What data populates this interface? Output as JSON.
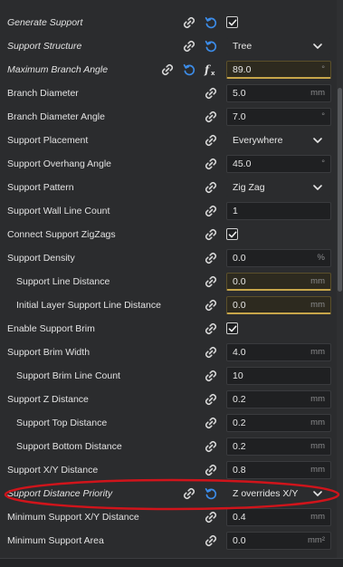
{
  "settings": {
    "rows": [
      {
        "label": "Generate Support",
        "italic": true,
        "indent": false,
        "type": "check",
        "checked": true,
        "icons": [
          "link",
          "reset"
        ]
      },
      {
        "label": "Support Structure",
        "italic": true,
        "indent": false,
        "type": "select",
        "value": "Tree",
        "icons": [
          "link",
          "reset"
        ]
      },
      {
        "label": "Maximum Branch Angle",
        "italic": true,
        "indent": false,
        "type": "field",
        "value": "89.0",
        "unit": "°",
        "warn": true,
        "icons": [
          "link",
          "reset",
          "fx"
        ]
      },
      {
        "label": "Branch Diameter",
        "italic": false,
        "indent": false,
        "type": "field",
        "value": "5.0",
        "unit": "mm",
        "icons": [
          "link"
        ]
      },
      {
        "label": "Branch Diameter Angle",
        "italic": false,
        "indent": false,
        "type": "field",
        "value": "7.0",
        "unit": "°",
        "icons": [
          "link"
        ]
      },
      {
        "label": "Support Placement",
        "italic": false,
        "indent": false,
        "type": "select",
        "value": "Everywhere",
        "icons": [
          "link"
        ]
      },
      {
        "label": "Support Overhang Angle",
        "italic": false,
        "indent": false,
        "type": "field",
        "value": "45.0",
        "unit": "°",
        "icons": [
          "link"
        ]
      },
      {
        "label": "Support Pattern",
        "italic": false,
        "indent": false,
        "type": "select",
        "value": "Zig Zag",
        "icons": [
          "link"
        ]
      },
      {
        "label": "Support Wall Line Count",
        "italic": false,
        "indent": false,
        "type": "field",
        "value": "1",
        "unit": "",
        "icons": [
          "link"
        ]
      },
      {
        "label": "Connect Support ZigZags",
        "italic": false,
        "indent": false,
        "type": "check",
        "checked": true,
        "icons": [
          "link"
        ]
      },
      {
        "label": "Support Density",
        "italic": false,
        "indent": false,
        "type": "field",
        "value": "0.0",
        "unit": "%",
        "icons": [
          "link"
        ]
      },
      {
        "label": "Support Line Distance",
        "italic": false,
        "indent": true,
        "type": "field",
        "value": "0.0",
        "unit": "mm",
        "warn": true,
        "icons": [
          "link"
        ]
      },
      {
        "label": "Initial Layer Support Line Distance",
        "italic": false,
        "indent": true,
        "type": "field",
        "value": "0.0",
        "unit": "mm",
        "warn": true,
        "icons": [
          "link"
        ]
      },
      {
        "label": "Enable Support Brim",
        "italic": false,
        "indent": false,
        "type": "check",
        "checked": true,
        "icons": [
          "link"
        ]
      },
      {
        "label": "Support Brim Width",
        "italic": false,
        "indent": false,
        "type": "field",
        "value": "4.0",
        "unit": "mm",
        "icons": [
          "link"
        ]
      },
      {
        "label": "Support Brim Line Count",
        "italic": false,
        "indent": true,
        "type": "field",
        "value": "10",
        "unit": "",
        "icons": [
          "link"
        ]
      },
      {
        "label": "Support Z Distance",
        "italic": false,
        "indent": false,
        "type": "field",
        "value": "0.2",
        "unit": "mm",
        "icons": [
          "link"
        ]
      },
      {
        "label": "Support Top Distance",
        "italic": false,
        "indent": true,
        "type": "field",
        "value": "0.2",
        "unit": "mm",
        "icons": [
          "link"
        ]
      },
      {
        "label": "Support Bottom Distance",
        "italic": false,
        "indent": true,
        "type": "field",
        "value": "0.2",
        "unit": "mm",
        "icons": [
          "link"
        ]
      },
      {
        "label": "Support X/Y Distance",
        "italic": false,
        "indent": false,
        "type": "field",
        "value": "0.8",
        "unit": "mm",
        "icons": [
          "link"
        ]
      },
      {
        "label": "Support Distance Priority",
        "italic": true,
        "indent": false,
        "type": "select",
        "value": "Z overrides X/Y",
        "icons": [
          "link",
          "reset"
        ]
      },
      {
        "label": "Minimum Support X/Y Distance",
        "italic": false,
        "indent": false,
        "type": "field",
        "value": "0.4",
        "unit": "mm",
        "icons": [
          "link"
        ]
      },
      {
        "label": "Minimum Support Area",
        "italic": false,
        "indent": false,
        "type": "field",
        "value": "0.0",
        "unit": "mm²",
        "icons": [
          "link"
        ]
      }
    ]
  },
  "colors": {
    "accent_blue": "#3c8ce8",
    "warning_underline": "#c7a64a",
    "highlight_ellipse": "#d0141b"
  },
  "icon_names": {
    "link": "link-icon",
    "reset": "reset-icon",
    "fx": "function-icon",
    "chevron": "chevron-down-icon",
    "check": "checkmark-icon"
  }
}
